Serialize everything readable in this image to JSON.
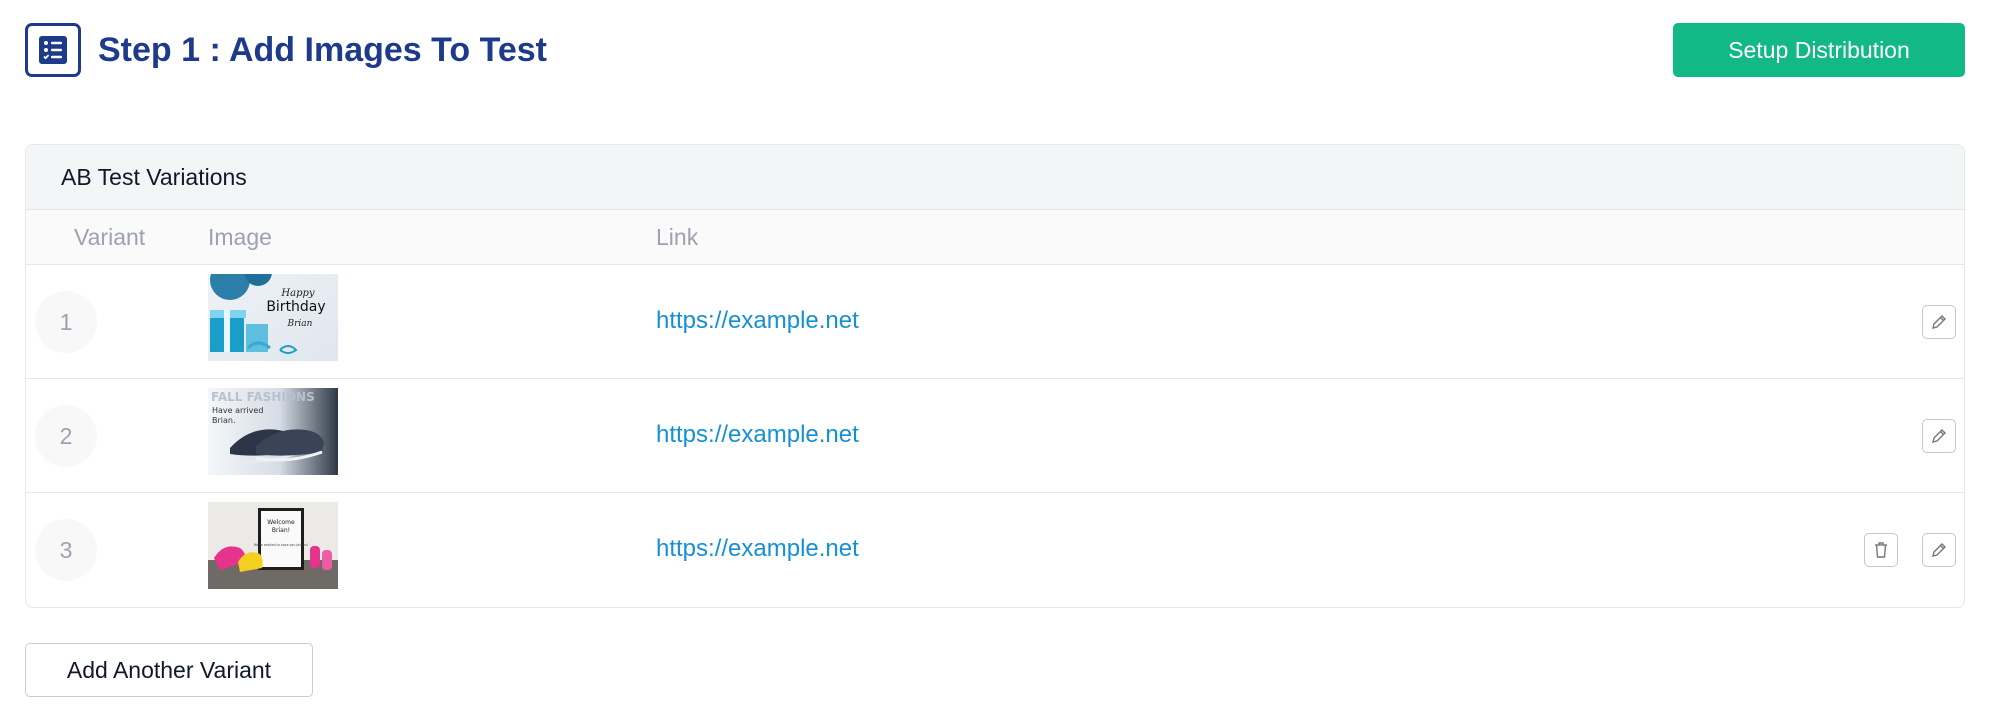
{
  "header": {
    "title": "Step 1 : Add Images To Test",
    "icon": "checklist-icon",
    "primary_action": "Setup Distribution"
  },
  "card": {
    "title": "AB Test Variations",
    "columns": {
      "variant": "Variant",
      "image": "Image",
      "link": "Link"
    },
    "rows": [
      {
        "variant": "1",
        "link": "https://example.net",
        "image": {
          "subject": "birthday-card",
          "text_line1": "Happy",
          "text_line2": "Birthday",
          "text_line3": "Brian"
        },
        "actions": [
          "edit"
        ]
      },
      {
        "variant": "2",
        "link": "https://example.net",
        "image": {
          "subject": "fall-fashions-shoes",
          "text_line1": "FALL FASHIONS",
          "text_line2": "Have arrived",
          "text_line3": "Brian."
        },
        "actions": [
          "edit"
        ]
      },
      {
        "variant": "3",
        "link": "https://example.net",
        "image": {
          "subject": "welcome-sign-sneakers",
          "text_line1": "Welcome",
          "text_line2": "Brian!",
          "text_line3": "We're excited to have you join us!"
        },
        "actions": [
          "delete",
          "edit"
        ]
      }
    ]
  },
  "footer": {
    "add_label": "Add Another Variant"
  },
  "colors": {
    "brand": "#1e3a8a",
    "accent": "#12b886",
    "link": "#1590d5",
    "muted": "#9ca3af"
  }
}
